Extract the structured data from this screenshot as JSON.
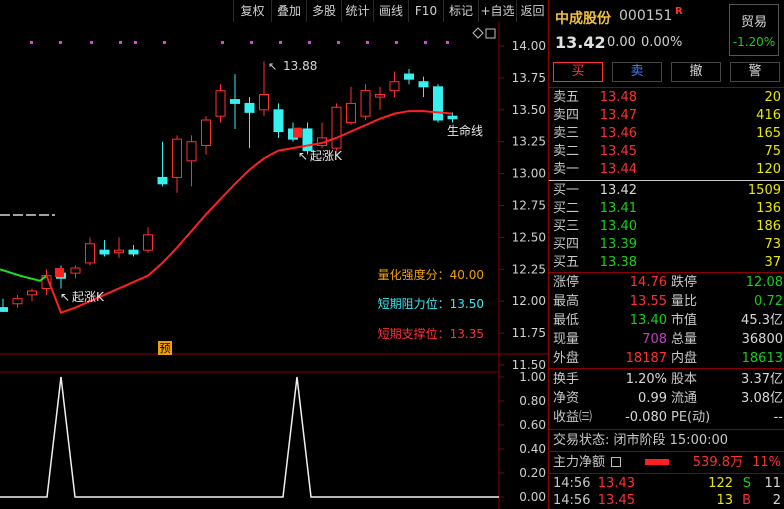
{
  "toolbar": {
    "items": [
      "复权",
      "叠加",
      "多股",
      "统计",
      "画线",
      "F10",
      "标记",
      "+自选",
      "返回"
    ]
  },
  "chart": {
    "price_axis": [
      "14.00",
      "13.75",
      "13.50",
      "13.25",
      "13.00",
      "12.75",
      "12.50",
      "12.25",
      "12.00",
      "11.75",
      "11.50"
    ],
    "indicator_axis": [
      "1.00",
      "0.80",
      "0.60",
      "0.40",
      "0.20",
      "0.00"
    ],
    "high_label": "13.88",
    "ma_label": "生命线",
    "signal_label_1": "起涨K",
    "signal_label_2": "起涨K",
    "badge": "预",
    "info": {
      "strength": "量化强度分：40.00",
      "resistance": "短期阻力位：13.50",
      "support": "短期支撑位：13.35"
    }
  },
  "chart_data": {
    "type": "candlestick",
    "ylim": [
      11.45,
      14.05
    ],
    "candles": [
      {
        "o": 11.95,
        "h": 12.02,
        "l": 11.92,
        "c": 11.92
      },
      {
        "o": 11.98,
        "h": 12.05,
        "l": 11.95,
        "c": 12.02
      },
      {
        "o": 12.05,
        "h": 12.1,
        "l": 12.0,
        "c": 12.08
      },
      {
        "o": 12.1,
        "h": 12.25,
        "l": 12.05,
        "c": 12.2
      },
      {
        "o": 12.22,
        "h": 12.28,
        "l": 12.1,
        "c": 12.18
      },
      {
        "o": 12.22,
        "h": 12.28,
        "l": 12.18,
        "c": 12.26
      },
      {
        "o": 12.3,
        "h": 12.5,
        "l": 12.28,
        "c": 12.45
      },
      {
        "o": 12.4,
        "h": 12.48,
        "l": 12.35,
        "c": 12.37
      },
      {
        "o": 12.38,
        "h": 12.5,
        "l": 12.34,
        "c": 12.4
      },
      {
        "o": 12.4,
        "h": 12.44,
        "l": 12.35,
        "c": 12.37
      },
      {
        "o": 12.4,
        "h": 12.58,
        "l": 12.38,
        "c": 12.52
      },
      {
        "o": 12.97,
        "h": 13.25,
        "l": 12.9,
        "c": 12.92
      },
      {
        "o": 12.97,
        "h": 13.3,
        "l": 12.85,
        "c": 13.27
      },
      {
        "o": 13.1,
        "h": 13.3,
        "l": 12.9,
        "c": 13.25
      },
      {
        "o": 13.22,
        "h": 13.45,
        "l": 13.15,
        "c": 13.42
      },
      {
        "o": 13.45,
        "h": 13.7,
        "l": 13.4,
        "c": 13.65
      },
      {
        "o": 13.58,
        "h": 13.78,
        "l": 13.35,
        "c": 13.55
      },
      {
        "o": 13.55,
        "h": 13.6,
        "l": 13.2,
        "c": 13.48
      },
      {
        "o": 13.5,
        "h": 13.88,
        "l": 13.45,
        "c": 13.62
      },
      {
        "o": 13.5,
        "h": 13.55,
        "l": 13.28,
        "c": 13.33
      },
      {
        "o": 13.35,
        "h": 13.4,
        "l": 13.25,
        "c": 13.27
      },
      {
        "o": 13.35,
        "h": 13.4,
        "l": 13.15,
        "c": 13.18
      },
      {
        "o": 13.22,
        "h": 13.4,
        "l": 13.2,
        "c": 13.28
      },
      {
        "o": 13.2,
        "h": 13.55,
        "l": 13.18,
        "c": 13.52
      },
      {
        "o": 13.4,
        "h": 13.68,
        "l": 13.38,
        "c": 13.55
      },
      {
        "o": 13.45,
        "h": 13.7,
        "l": 13.42,
        "c": 13.65
      },
      {
        "o": 13.6,
        "h": 13.68,
        "l": 13.5,
        "c": 13.62
      },
      {
        "o": 13.65,
        "h": 13.8,
        "l": 13.6,
        "c": 13.72
      },
      {
        "o": 13.78,
        "h": 13.82,
        "l": 13.7,
        "c": 13.74
      },
      {
        "o": 13.72,
        "h": 13.76,
        "l": 13.6,
        "c": 13.68
      },
      {
        "o": 13.68,
        "h": 13.7,
        "l": 13.4,
        "c": 13.42
      },
      {
        "o": 13.45,
        "h": 13.48,
        "l": 13.4,
        "c": 13.43
      }
    ],
    "ma": [
      11.8,
      11.82,
      11.84,
      11.87,
      11.91,
      11.95,
      12.0,
      12.05,
      12.1,
      12.15,
      12.2,
      12.3,
      12.42,
      12.55,
      12.68,
      12.8,
      12.92,
      13.03,
      13.12,
      13.18,
      13.2,
      13.22,
      13.24,
      13.28,
      13.33,
      13.38,
      13.43,
      13.47,
      13.49,
      13.49,
      13.48,
      13.47
    ],
    "indicator": [
      0,
      0,
      0,
      0,
      0,
      0,
      0,
      0,
      0,
      0,
      0,
      0,
      0,
      0,
      0,
      0,
      0,
      0,
      0,
      0,
      0,
      0,
      0,
      0,
      0,
      0,
      0,
      0,
      0,
      0,
      0,
      0
    ],
    "indicator_peaks": [
      {
        "at": 3,
        "value": 1.0
      },
      {
        "at": 20,
        "value": 1.0
      }
    ]
  },
  "quote": {
    "name": "中成股份",
    "code": "000151",
    "flag": "R",
    "sector": "贸易",
    "sector_pct": "-1.20%",
    "price": "13.42",
    "change": "0.00",
    "pct": "0.00%",
    "buttons": [
      "买",
      "卖",
      "撤",
      "警"
    ],
    "asks": [
      {
        "label": "卖五",
        "price": "13.48",
        "vol": "20"
      },
      {
        "label": "卖四",
        "price": "13.47",
        "vol": "416"
      },
      {
        "label": "卖三",
        "price": "13.46",
        "vol": "165"
      },
      {
        "label": "卖二",
        "price": "13.45",
        "vol": "75"
      },
      {
        "label": "卖一",
        "price": "13.44",
        "vol": "120"
      }
    ],
    "bids": [
      {
        "label": "买一",
        "price": "13.42",
        "vol": "1509"
      },
      {
        "label": "买二",
        "price": "13.41",
        "vol": "136"
      },
      {
        "label": "买三",
        "price": "13.40",
        "vol": "186"
      },
      {
        "label": "买四",
        "price": "13.39",
        "vol": "73"
      },
      {
        "label": "买五",
        "price": "13.38",
        "vol": "37"
      }
    ],
    "stats1": [
      {
        "k1": "涨停",
        "v1": "14.76",
        "k2": "跌停",
        "v2": "12.08"
      },
      {
        "k1": "最高",
        "v1": "13.55",
        "k2": "量比",
        "v2": "0.72"
      },
      {
        "k1": "最低",
        "v1": "13.40",
        "k2": "市值",
        "v2": "45.3亿"
      },
      {
        "k1": "现量",
        "v1": "708",
        "k2": "总量",
        "v2": "36800"
      },
      {
        "k1": "外盘",
        "v1": "18187",
        "k2": "内盘",
        "v2": "18613"
      }
    ],
    "stats2": [
      {
        "k1": "换手",
        "v1": "1.20%",
        "k2": "股本",
        "v2": "3.37亿"
      },
      {
        "k1": "净资",
        "v1": "0.99",
        "k2": "流通",
        "v2": "3.08亿"
      },
      {
        "k1": "收益㈢",
        "v1": "-0.080",
        "k2": "PE(动)",
        "v2": "--"
      }
    ],
    "status": "交易状态: 闭市阶段 15:00:00",
    "main_flow_label": "主力净额",
    "main_flow_value": "539.8万",
    "main_flow_pct": "11%",
    "ticks": [
      {
        "time": "14:56",
        "price": "13.43",
        "vol": "122",
        "side": "S",
        "n": "11"
      },
      {
        "time": "14:56",
        "price": "13.45",
        "vol": "13",
        "side": "B",
        "n": "2"
      }
    ]
  },
  "colors": {
    "up": "#ff3030",
    "down": "#38f0f0",
    "ma": "#ff2020",
    "grid": "#8b0000",
    "green": "#16d016",
    "yellow": "#e8e800",
    "orange": "#f0a000"
  }
}
